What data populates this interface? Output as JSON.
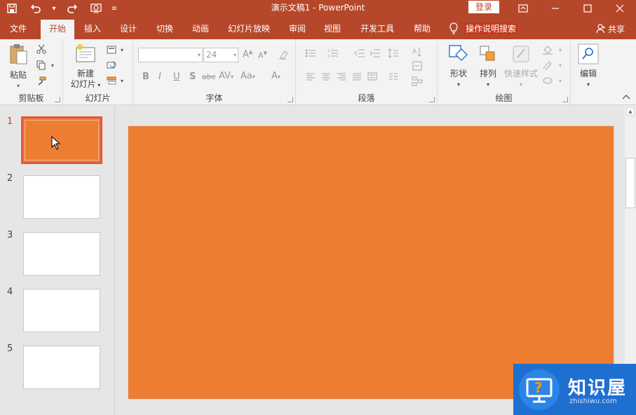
{
  "window": {
    "title": "演示文稿1 - PowerPoint",
    "login_label": "登录",
    "share_label": "共享"
  },
  "tabs": [
    "文件",
    "开始",
    "插入",
    "设计",
    "切换",
    "动画",
    "幻灯片放映",
    "审阅",
    "视图",
    "开发工具",
    "帮助"
  ],
  "active_tab": "开始",
  "tell_me": {
    "label": "操作说明搜索"
  },
  "ribbon": {
    "clipboard": {
      "label": "剪贴板",
      "paste_label": "粘贴"
    },
    "slides": {
      "label": "幻灯片",
      "new_slide_line1": "新建",
      "new_slide_line2": "幻灯片"
    },
    "font": {
      "label": "字体",
      "font_name": "",
      "font_size": "24"
    },
    "paragraph": {
      "label": "段落"
    },
    "drawing": {
      "label": "绘图",
      "shapes_label": "形状",
      "arrange_label": "排列",
      "quick_styles_label": "快速样式"
    },
    "editing": {
      "label": "编辑"
    }
  },
  "slides": [
    {
      "number": "1",
      "selected": true
    },
    {
      "number": "2",
      "selected": false
    },
    {
      "number": "3",
      "selected": false
    },
    {
      "number": "4",
      "selected": false
    },
    {
      "number": "5",
      "selected": false
    }
  ],
  "watermark": {
    "title": "知识屋",
    "url": "zhishiwu.com"
  },
  "colors": {
    "accent": "#b7472a",
    "slide_fill": "#ed7d31",
    "watermark_bg": "#1f6fd0"
  }
}
